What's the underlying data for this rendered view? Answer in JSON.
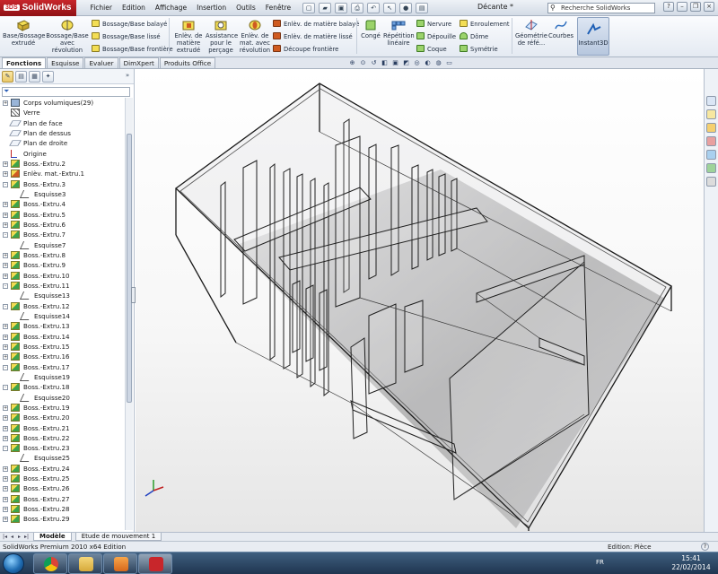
{
  "app": {
    "brand": "SolidWorks",
    "brand_prefix": "3DS",
    "document_title": "Décante *",
    "search_placeholder": "Recherche SolidWorks"
  },
  "menu": [
    "Fichier",
    "Edition",
    "Affichage",
    "Insertion",
    "Outils",
    "Fenêtre"
  ],
  "ribbon": {
    "bossage_extrude": "Base/Bossage extrudé",
    "bossage_revolution": "Bossage/Base avec révolution",
    "balaye": "Bossage/Base balayé",
    "lisse": "Bossage/Base lissé",
    "frontiere": "Bossage/Base frontière",
    "enlev_extrude": "Enlèv. de matière extrudé",
    "assistance_percage": "Assistance pour le perçage",
    "enlev_revolution": "Enlèv. de mat. avec révolution",
    "enlev_balaye": "Enlèv. de matière balayé",
    "enlev_lisse": "Enlèv. de matière lissé",
    "decoupe_frontiere": "Découpe frontière",
    "conge": "Congé",
    "repetition": "Répétition linéaire",
    "nervure": "Nervure",
    "depouille": "Dépouille",
    "coque": "Coque",
    "enroulement": "Enroulement",
    "dome": "Dôme",
    "symetrie": "Symétrie",
    "geometrie": "Géométrie de réfé...",
    "courbes": "Courbes",
    "instant3d": "Instant3D"
  },
  "tabs": [
    "Fonctions",
    "Esquisse",
    "Evaluer",
    "DimXpert",
    "Produits Office"
  ],
  "tree": [
    {
      "label": "Corps volumiques(29)",
      "icon": "body",
      "level": 0,
      "toggle": "+"
    },
    {
      "label": "Verre",
      "icon": "material",
      "level": 0,
      "toggle": ""
    },
    {
      "label": "Plan de face",
      "icon": "plane",
      "level": 0,
      "toggle": ""
    },
    {
      "label": "Plan de dessus",
      "icon": "plane",
      "level": 0,
      "toggle": ""
    },
    {
      "label": "Plan de droite",
      "icon": "plane",
      "level": 0,
      "toggle": ""
    },
    {
      "label": "Origine",
      "icon": "origin",
      "level": 0,
      "toggle": ""
    },
    {
      "label": "Boss.-Extru.2",
      "icon": "feature",
      "level": 0,
      "toggle": "+"
    },
    {
      "label": "Enlèv. mat.-Extru.1",
      "icon": "cut",
      "level": 0,
      "toggle": "+"
    },
    {
      "label": "Boss.-Extru.3",
      "icon": "feature",
      "level": 0,
      "toggle": "-"
    },
    {
      "label": "Esquisse3",
      "icon": "sketch",
      "level": 1,
      "toggle": ""
    },
    {
      "label": "Boss.-Extru.4",
      "icon": "feature",
      "level": 0,
      "toggle": "+"
    },
    {
      "label": "Boss.-Extru.5",
      "icon": "feature",
      "level": 0,
      "toggle": "+"
    },
    {
      "label": "Boss.-Extru.6",
      "icon": "feature",
      "level": 0,
      "toggle": "+"
    },
    {
      "label": "Boss.-Extru.7",
      "icon": "feature",
      "level": 0,
      "toggle": "-"
    },
    {
      "label": "Esquisse7",
      "icon": "sketch",
      "level": 1,
      "toggle": ""
    },
    {
      "label": "Boss.-Extru.8",
      "icon": "feature",
      "level": 0,
      "toggle": "+"
    },
    {
      "label": "Boss.-Extru.9",
      "icon": "feature",
      "level": 0,
      "toggle": "+"
    },
    {
      "label": "Boss.-Extru.10",
      "icon": "feature",
      "level": 0,
      "toggle": "+"
    },
    {
      "label": "Boss.-Extru.11",
      "icon": "feature",
      "level": 0,
      "toggle": "-"
    },
    {
      "label": "Esquisse13",
      "icon": "sketch",
      "level": 1,
      "toggle": ""
    },
    {
      "label": "Boss.-Extru.12",
      "icon": "feature",
      "level": 0,
      "toggle": "-"
    },
    {
      "label": "Esquisse14",
      "icon": "sketch",
      "level": 1,
      "toggle": ""
    },
    {
      "label": "Boss.-Extru.13",
      "icon": "feature",
      "level": 0,
      "toggle": "+"
    },
    {
      "label": "Boss.-Extru.14",
      "icon": "feature",
      "level": 0,
      "toggle": "+"
    },
    {
      "label": "Boss.-Extru.15",
      "icon": "feature",
      "level": 0,
      "toggle": "+"
    },
    {
      "label": "Boss.-Extru.16",
      "icon": "feature",
      "level": 0,
      "toggle": "+"
    },
    {
      "label": "Boss.-Extru.17",
      "icon": "feature",
      "level": 0,
      "toggle": "-"
    },
    {
      "label": "Esquisse19",
      "icon": "sketch",
      "level": 1,
      "toggle": ""
    },
    {
      "label": "Boss.-Extru.18",
      "icon": "feature",
      "level": 0,
      "toggle": "-"
    },
    {
      "label": "Esquisse20",
      "icon": "sketch",
      "level": 1,
      "toggle": ""
    },
    {
      "label": "Boss.-Extru.19",
      "icon": "feature",
      "level": 0,
      "toggle": "+"
    },
    {
      "label": "Boss.-Extru.20",
      "icon": "feature",
      "level": 0,
      "toggle": "+"
    },
    {
      "label": "Boss.-Extru.21",
      "icon": "feature",
      "level": 0,
      "toggle": "+"
    },
    {
      "label": "Boss.-Extru.22",
      "icon": "feature",
      "level": 0,
      "toggle": "+"
    },
    {
      "label": "Boss.-Extru.23",
      "icon": "feature",
      "level": 0,
      "toggle": "-"
    },
    {
      "label": "Esquisse25",
      "icon": "sketch",
      "level": 1,
      "toggle": ""
    },
    {
      "label": "Boss.-Extru.24",
      "icon": "feature",
      "level": 0,
      "toggle": "+"
    },
    {
      "label": "Boss.-Extru.25",
      "icon": "feature",
      "level": 0,
      "toggle": "+"
    },
    {
      "label": "Boss.-Extru.26",
      "icon": "feature",
      "level": 0,
      "toggle": "+"
    },
    {
      "label": "Boss.-Extru.27",
      "icon": "feature",
      "level": 0,
      "toggle": "+"
    },
    {
      "label": "Boss.-Extru.28",
      "icon": "feature",
      "level": 0,
      "toggle": "+"
    },
    {
      "label": "Boss.-Extru.29",
      "icon": "feature",
      "level": 0,
      "toggle": "+"
    }
  ],
  "bottom_tabs": [
    "Modèle",
    "Etude de mouvement 1"
  ],
  "status": {
    "left": "SolidWorks Premium 2010 x64 Edition",
    "right": "Edition: Pièce",
    "help": "?"
  },
  "taskbar": {
    "language": "FR",
    "time": "15:41",
    "date": "22/02/2014"
  },
  "colors": {
    "accent": "#c8262b",
    "ribbon_bg": "#e4eaf2",
    "feature_icon": "#3da34a"
  }
}
